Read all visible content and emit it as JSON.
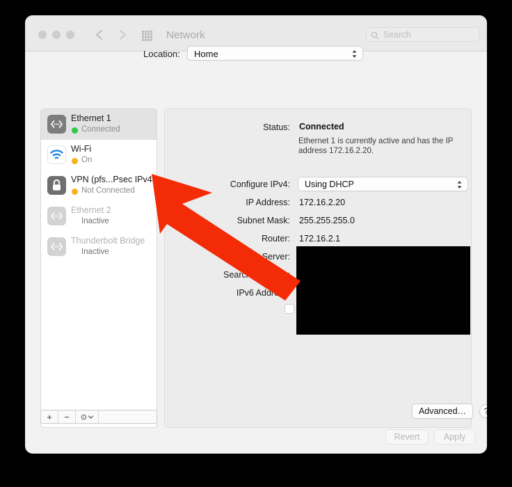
{
  "window": {
    "title": "Network",
    "traffic_lights": [
      "close",
      "minimize",
      "zoom"
    ],
    "nav": {
      "back": "back-arrow",
      "forward": "forward-arrow"
    },
    "grid_icon": "all-preferences-grid-icon"
  },
  "search": {
    "placeholder": "Search",
    "icon": "search-icon"
  },
  "location": {
    "label": "Location:",
    "value": "Home"
  },
  "sidebar": {
    "services": [
      {
        "name": "Ethernet 1",
        "status": "Connected",
        "dot": "green",
        "icon": "ethernet-icon",
        "selected": true,
        "disabled": false
      },
      {
        "name": "Wi-Fi",
        "status": "On",
        "dot": "amber",
        "icon": "wifi-icon",
        "selected": false,
        "disabled": false
      },
      {
        "name": "VPN (pfs...Psec IPv4",
        "status": "Not Connected",
        "dot": "amber",
        "icon": "vpn-lock-icon",
        "selected": false,
        "disabled": false
      },
      {
        "name": "Ethernet 2",
        "status": "Inactive",
        "dot": "none",
        "icon": "ethernet-icon",
        "selected": false,
        "disabled": true
      },
      {
        "name": "Thunderbolt Bridge",
        "status": "Inactive",
        "dot": "none",
        "icon": "ethernet-icon",
        "selected": false,
        "disabled": true
      }
    ],
    "toolbar": {
      "add": "+",
      "remove": "−",
      "action_menu": "⊙",
      "action_menu_chevron": "⌄"
    }
  },
  "detail": {
    "status_label": "Status:",
    "status_value": "Connected",
    "status_description": "Ethernet 1 is currently active and has the IP address 172.16.2.20.",
    "configure_ipv4_label": "Configure IPv4:",
    "configure_ipv4_value": "Using DHCP",
    "ip_address_label": "IP Address:",
    "ip_address_value": "172.16.2.20",
    "subnet_mask_label": "Subnet Mask:",
    "subnet_mask_value": "255.255.255.0",
    "router_label": "Router:",
    "router_value": "172.16.2.1",
    "dns_server_label": "DNS Server:",
    "search_domains_label": "Search Domains:",
    "ipv6_address_label": "IPv6 Address:",
    "advanced_button": "Advanced…",
    "help_button": "?"
  },
  "footer": {
    "revert_button": "Revert",
    "apply_button": "Apply"
  },
  "annotation": {
    "type": "red-arrow",
    "color": "#f42b07",
    "points_to": "VPN (pfs...Psec IPv4"
  },
  "colors": {
    "accent_connected": "#30c84b",
    "accent_warning": "#f5b319",
    "annotation_red": "#f42b07",
    "window_bg": "#f2f2f2",
    "detail_bg": "#ececec"
  }
}
